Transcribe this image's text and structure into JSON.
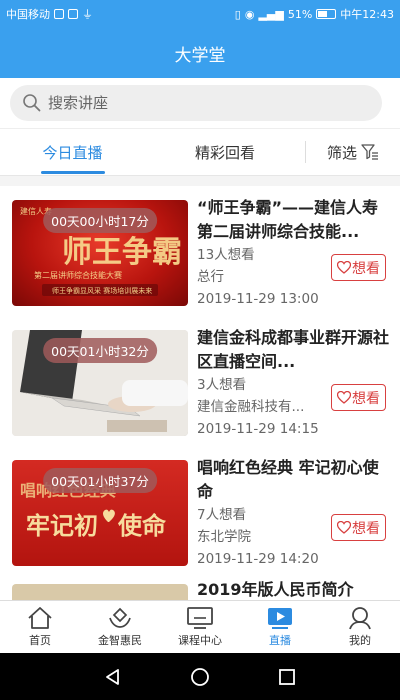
{
  "status_bar": {
    "carrier": "中国移动",
    "battery": "51%",
    "time": "中午12:43"
  },
  "header": {
    "title": "大学堂"
  },
  "search": {
    "placeholder": "搜索讲座"
  },
  "tabs": [
    {
      "label": "今日直播",
      "active": true
    },
    {
      "label": "精彩回看",
      "active": false
    }
  ],
  "filter": {
    "label": "筛选"
  },
  "courses": [
    {
      "countdown": "00天00小时17分",
      "title": "“师王争霸”——建信人寿第二届讲师综合技能...",
      "want_count": "13人想看",
      "org": "总行",
      "datetime": "2019-11-29 13:00",
      "want_label": "想看",
      "thumb_theme": "red-event"
    },
    {
      "countdown": "00天01小时32分",
      "title": "建信金科成都事业群开源社区直播空间...",
      "want_count": "3人想看",
      "org": "建信金融科技有...",
      "datetime": "2019-11-29 14:15",
      "want_label": "想看",
      "thumb_theme": "laptop"
    },
    {
      "countdown": "00天01小时37分",
      "title": "唱响红色经典 牢记初心使命",
      "want_count": "7人想看",
      "org": "东北学院",
      "datetime": "2019-11-29 14:20",
      "want_label": "想看",
      "thumb_theme": "red-banner"
    },
    {
      "title": "2019年版人民币简介"
    }
  ],
  "tabbar": [
    {
      "label": "首页",
      "icon": "home-icon",
      "active": false
    },
    {
      "label": "金智惠民",
      "icon": "hands-icon",
      "active": false
    },
    {
      "label": "课程中心",
      "icon": "monitor-icon",
      "active": false
    },
    {
      "label": "直播",
      "icon": "play-icon",
      "active": true
    },
    {
      "label": "我的",
      "icon": "user-icon",
      "active": false
    }
  ],
  "colors": {
    "primary": "#3aa0ee",
    "accent": "#2c8be0",
    "want_red": "#d84040"
  }
}
